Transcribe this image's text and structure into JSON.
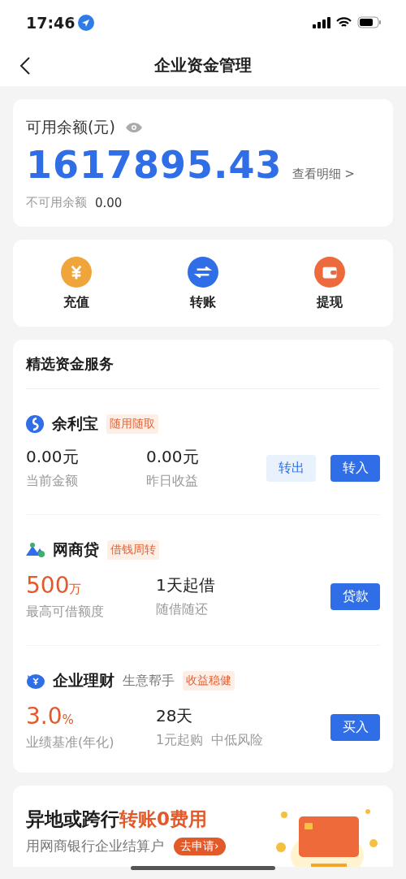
{
  "status_bar": {
    "time": "17:46"
  },
  "nav": {
    "title": "企业资金管理"
  },
  "balance": {
    "label": "可用余额(元)",
    "amount": "1617895.43",
    "detail_link": "查看明细 >",
    "unavailable_label": "不可用余额",
    "unavailable_value": "0.00"
  },
  "actions": [
    {
      "kind": "recharge",
      "label": "充值",
      "color": "#f0a53a"
    },
    {
      "kind": "transfer",
      "label": "转账",
      "color": "#2f6ee6"
    },
    {
      "kind": "withdraw",
      "label": "提现",
      "color": "#ec6a3c"
    }
  ],
  "services": {
    "title": "精选资金服务",
    "products": [
      {
        "kind": "yulibao",
        "name": "余利宝",
        "tag": "随用随取",
        "stats": [
          {
            "kind": "plain",
            "value": "0.00元",
            "label": "当前金额"
          },
          {
            "kind": "plain",
            "value": "0.00元",
            "label": "昨日收益"
          }
        ],
        "buttons": [
          {
            "kind": "secondary",
            "label": "转出"
          },
          {
            "kind": "primary",
            "label": "转入"
          }
        ]
      },
      {
        "kind": "loan",
        "name": "网商贷",
        "tag": "借钱周转",
        "stats": [
          {
            "kind": "highlight",
            "value": "500",
            "unit": "万",
            "label": "最高可借额度"
          },
          {
            "kind": "plain",
            "value": "1天起借",
            "label": "随借随还"
          }
        ],
        "buttons": [
          {
            "kind": "primary",
            "label": "贷款"
          }
        ]
      },
      {
        "kind": "wealth",
        "name": "企业理财",
        "subtitle": "生意帮手",
        "tag": "收益稳健",
        "stats": [
          {
            "kind": "highlight",
            "value": "3.0",
            "unit": "%",
            "label": "业绩基准(年化)"
          },
          {
            "kind": "plain",
            "value": "28天",
            "label": "1元起购  中低风险"
          }
        ],
        "buttons": [
          {
            "kind": "primary",
            "label": "买入"
          }
        ]
      }
    ]
  },
  "banner": {
    "title_lead": "异地或跨行",
    "title_highlight": "转账0费用",
    "subtitle": "用网商银行企业结算户",
    "button": "去申请›"
  }
}
